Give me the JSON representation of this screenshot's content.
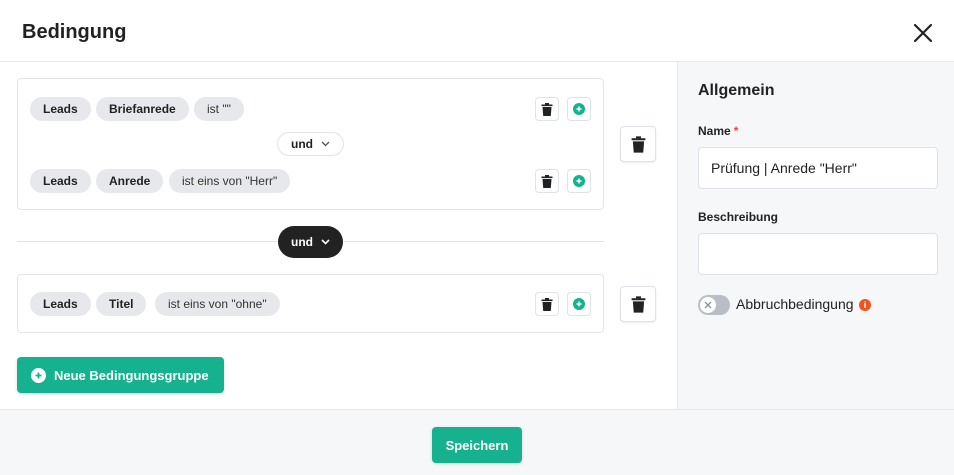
{
  "dialog": {
    "title": "Bedingung"
  },
  "groups": [
    {
      "rules": [
        {
          "entity": "Leads",
          "field": "Briefanrede",
          "operator": "ist \"\""
        },
        {
          "entity": "Leads",
          "field": "Anrede",
          "operator": "ist eins von \"Herr\""
        }
      ],
      "conjunction": "und"
    },
    {
      "rules": [
        {
          "entity": "Leads",
          "field": "Titel",
          "operator": "ist eins von \"ohne\""
        }
      ]
    }
  ],
  "group_conjunction": "und",
  "new_group_label": "Neue Bedingungsgruppe",
  "side_panel": {
    "heading": "Allgemein",
    "name_label": "Name",
    "name_required_mark": "*",
    "name_value": "Prüfung | Anrede \"Herr\"",
    "description_label": "Beschreibung",
    "description_value": "",
    "abort_label": "Abbruchbedingung",
    "abort_enabled": false,
    "info_glyph": "i"
  },
  "footer": {
    "save_label": "Speichern"
  },
  "colors": {
    "accent": "#16b28f",
    "dark_pill": "#222222",
    "info": "#f0541e"
  },
  "icons": [
    "close-icon",
    "trash-icon",
    "plus-circle-icon",
    "chevron-down-icon",
    "x-icon",
    "info-icon"
  ]
}
